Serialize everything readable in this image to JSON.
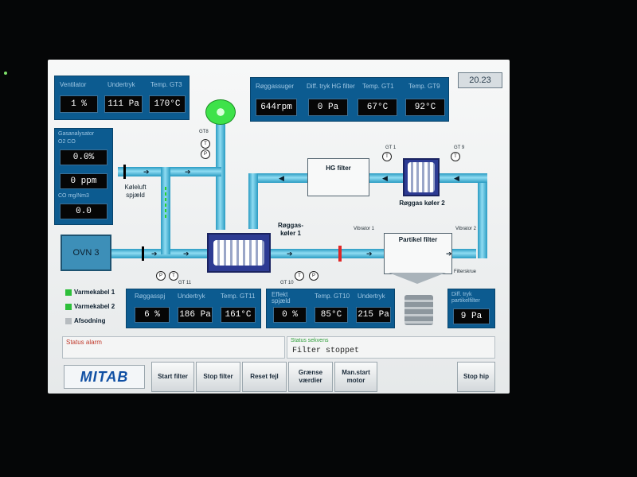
{
  "screen": {
    "clock": "20.23"
  },
  "panel_left_top": {
    "labels": [
      "Ventilator",
      "Undertryk",
      "Temp. GT3"
    ],
    "values": [
      "1 %",
      "111 Pa",
      "170°C"
    ]
  },
  "panel_top_right": {
    "labels": [
      "Røggassuger",
      "Diff. tryk HG filter",
      "Temp. GT1",
      "Temp. GT9"
    ],
    "values": [
      "644rpm",
      "0 Pa",
      "67°C",
      "92°C"
    ]
  },
  "panel_gas": {
    "header1": "Gasanalysator",
    "header2": "O2 CO",
    "values": [
      "0.0%",
      "0 ppm",
      "0.0"
    ],
    "label3": "CO mg/Nm3"
  },
  "ovn_button": "OVN 3",
  "legend": [
    {
      "label": "Varmekabel 1",
      "color": "#2dbf3a"
    },
    {
      "label": "Varmekabel 2",
      "color": "#2dbf3a"
    },
    {
      "label": "Afsodning",
      "color": "#b7bcc0"
    }
  ],
  "panel_bottom_a": {
    "labels": [
      "Røggasspj",
      "Undertryk",
      "Temp. GT11"
    ],
    "values": [
      "6 %",
      "186 Pa",
      "161°C"
    ]
  },
  "panel_bottom_b": {
    "labels": [
      "Effekt spjæld",
      "Temp. GT10",
      "Undertryk"
    ],
    "values": [
      "0 %",
      "85°C",
      "215 Pa"
    ]
  },
  "panel_bottom_c": {
    "label": "Diff. tryk partikelfilter",
    "value": "9 Pa"
  },
  "diagram": {
    "koleluft": "Køleluft spjæld",
    "hg_filter": "HG filter",
    "roggas_koler_1": "Røggas- køler 1",
    "roggas_koler_2": "Røggas køler 2",
    "partikel_filter": "Partikel filter",
    "vibrator_1": "Vibrator 1",
    "vibrator_2": "Vibrator 2",
    "filtersnegl": "Filterskrue",
    "gt8": "GT8",
    "gt1": "GT 1",
    "gt9": "GT 9",
    "gt11": "GT 11",
    "gt10": "GT 10",
    "t": "T",
    "p": "P"
  },
  "status": {
    "alarm_label": "Status alarm",
    "sequence_label": "Status sekvens",
    "sequence_value": "Filter stoppet"
  },
  "footer": {
    "logo": "MITAB",
    "buttons": [
      "Start filter",
      "Stop filter",
      "Reset fejl",
      "Grænse værdier",
      "Man.start motor"
    ],
    "stop": "Stop hip"
  },
  "colors": {
    "panel": "#0c5b90",
    "pipe": "#2a9bc2",
    "value_bg": "#060606",
    "alarm_red": "#c0392b",
    "sequence_green": "#2f9e3a"
  }
}
